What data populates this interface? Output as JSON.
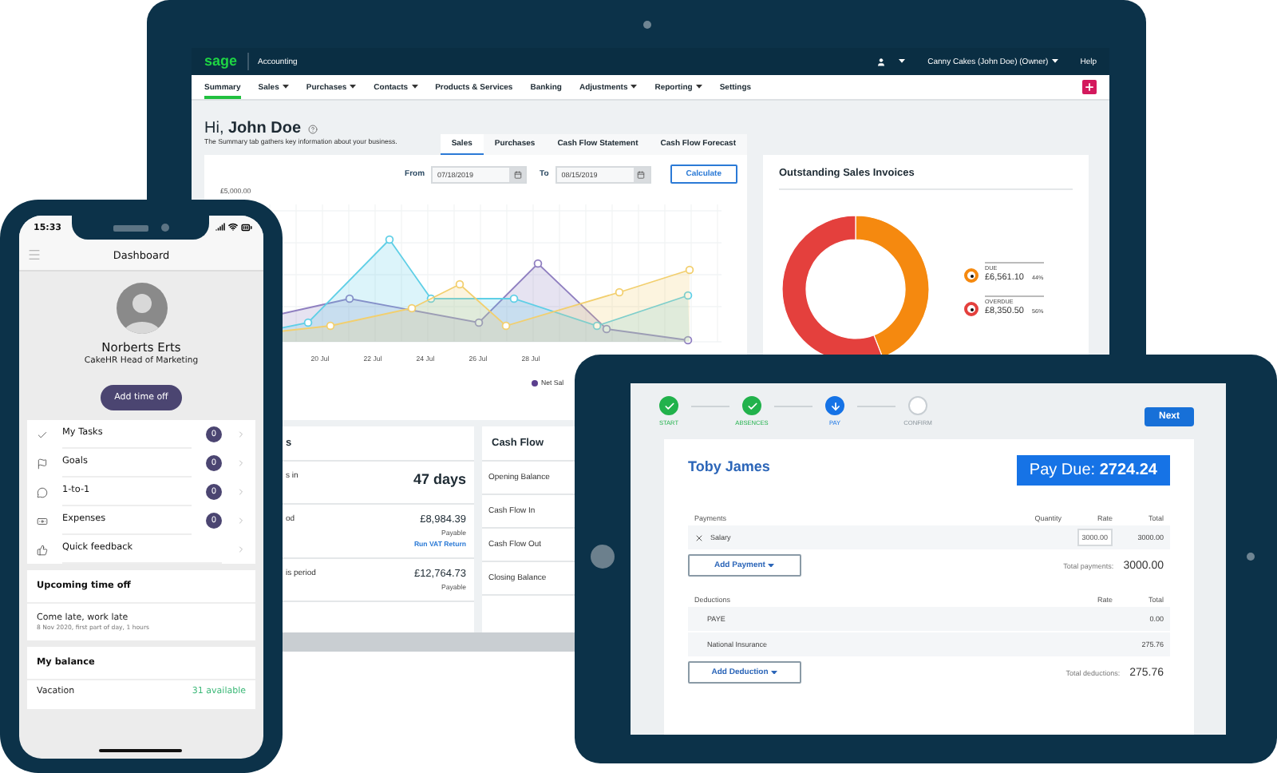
{
  "laptop": {
    "header": {
      "logo": "sage",
      "product": "Accounting",
      "account": "Canny Cakes (John Doe) (Owner)",
      "help": "Help"
    },
    "nav": [
      {
        "label": "Summary",
        "selected": true,
        "dropdown": false
      },
      {
        "label": "Sales",
        "selected": false,
        "dropdown": true
      },
      {
        "label": "Purchases",
        "selected": false,
        "dropdown": true
      },
      {
        "label": "Contacts",
        "selected": false,
        "dropdown": true
      },
      {
        "label": "Products & Services",
        "selected": false,
        "dropdown": false
      },
      {
        "label": "Banking",
        "selected": false,
        "dropdown": false
      },
      {
        "label": "Adjustments",
        "selected": false,
        "dropdown": true
      },
      {
        "label": "Reporting",
        "selected": false,
        "dropdown": true
      },
      {
        "label": "Settings",
        "selected": false,
        "dropdown": false
      }
    ],
    "greeting": "Hi, **John Doe**",
    "subtitle": "The Summary tab gathers key information about your business.",
    "tabs": [
      {
        "label": "Sales",
        "selected": true
      },
      {
        "label": "Purchases",
        "selected": false
      },
      {
        "label": "Cash Flow Statement",
        "selected": false
      },
      {
        "label": "Cash Flow Forecast",
        "selected": false
      }
    ],
    "date_range": {
      "from_label": "From",
      "from": "07/18/2019",
      "to_label": "To",
      "to": "08/15/2019",
      "button": "Calculate"
    },
    "sales_chart": {
      "y_label": "£5,000.00",
      "x_labels": [
        "20 Jul",
        "22 Jul",
        "24 Jul",
        "26 Jul",
        "28 Jul"
      ],
      "legend": "Net Sal"
    },
    "invoices": {
      "title": "Outstanding Sales Invoices",
      "chart_data": {
        "type": "donut",
        "categories": [
          "DUE",
          "OVERDUE"
        ],
        "values": [
          44,
          56
        ]
      },
      "legend": [
        {
          "amount": "£6,561.10",
          "percent": "44%",
          "color": "#f5890f"
        },
        {
          "amount": "£8,350.50",
          "percent": "56%",
          "color": "#e4403d"
        }
      ]
    },
    "summary_panel": {
      "title": "s",
      "rows": [
        {
          "label": "s in",
          "value": "47 days",
          "kind": "large"
        },
        {
          "label": "od",
          "value": "£8,984.39",
          "note": "Payable",
          "link": "Run VAT Return",
          "kind": "amount"
        },
        {
          "label": "is period",
          "value": "£12,764.73",
          "note": "Payable",
          "kind": "amount"
        }
      ]
    },
    "cash_flow": {
      "title": "Cash Flow",
      "rows": [
        "Opening Balance",
        "Cash Flow In",
        "Cash Flow Out",
        "Closing Balance"
      ]
    }
  },
  "phone": {
    "time": "15:33",
    "title": "Dashboard",
    "name": "Norberts Erts",
    "role": "CakeHR Head of Marketing",
    "button": "Add time off",
    "items": [
      {
        "label": "My Tasks",
        "kind": "tasks",
        "count": "0"
      },
      {
        "label": "Goals",
        "kind": "goals",
        "count": "0"
      },
      {
        "label": "1-to-1",
        "kind": "chat",
        "count": "0"
      },
      {
        "label": "Expenses",
        "kind": "expenses",
        "count": "0"
      },
      {
        "label": "Quick feedback",
        "kind": "feedback"
      }
    ],
    "upcoming": {
      "title": "Upcoming time off",
      "entry": "Come late, work late",
      "detail": "8 Nov 2020, first part of day, 1 hours"
    },
    "balance": {
      "title": "My balance",
      "label": "Vacation",
      "value": "31 available"
    }
  },
  "tablet": {
    "steps": [
      {
        "label": "START",
        "kind": "done"
      },
      {
        "label": "ABSENCES",
        "kind": "done"
      },
      {
        "label": "PAY",
        "kind": "current"
      },
      {
        "label": "CONFIRM",
        "kind": "pending"
      }
    ],
    "next": "Next",
    "employee": "Toby James",
    "pay_due": "Pay Due: **2724.24**",
    "payments": {
      "columns": [
        "Payments",
        "Quantity",
        "Rate",
        "Total"
      ],
      "rows": [
        {
          "name": "Salary",
          "rate": "3000.00",
          "total": "3000.00"
        }
      ],
      "button": "Add Payment",
      "total_label": "Total payments:",
      "total": "3000.00"
    },
    "deductions": {
      "columns": [
        "Deductions",
        "Rate",
        "Total"
      ],
      "rows": [
        {
          "name": "PAYE",
          "total": "0.00"
        },
        {
          "name": "National Insurance",
          "total": "275.76"
        }
      ],
      "button": "Add Deduction",
      "total_label": "Total deductions:",
      "total": "275.76"
    }
  }
}
